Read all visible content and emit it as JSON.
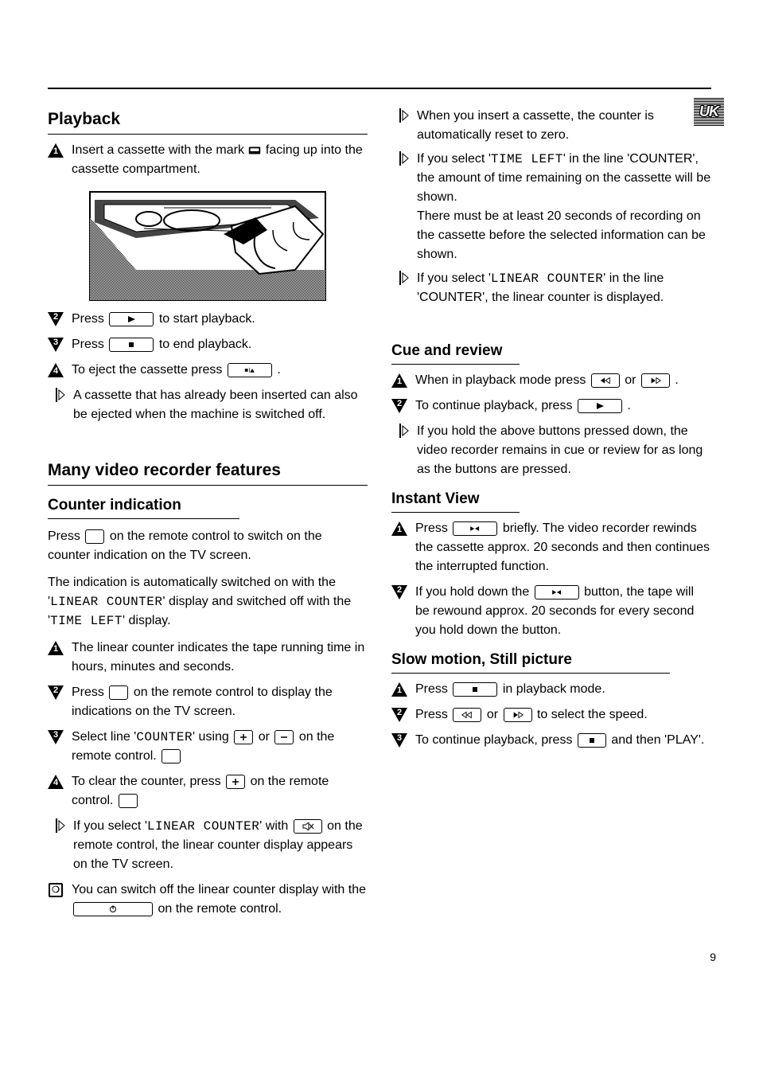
{
  "badge": "UK",
  "page_number": "9",
  "left": {
    "playback_title": "Playback",
    "s1": "Insert a cassette with the mark",
    "s1_cont": "facing up into the cassette compartment.",
    "s2_a": "Press",
    "s2_b": "to start playback.",
    "s3_a": "Press",
    "s3_b": "to end playback.",
    "s4_a": "To eject the cassette press",
    "s4_b": ".",
    "h1": "A cassette that has already been inserted can also be ejected when the machine is switched off.",
    "feat_title": "Many video recorder features",
    "ct_title": "Counter indication",
    "ct_p1a": "Press",
    "ct_p1b": "on the remote control to switch on the counter indication on the TV screen.",
    "ct_p2a": "The indication is automatically switched on with the",
    "ct_p2b": "display and switched off with the",
    "ct_p2c": "display.",
    "ct_s1": "The linear counter indicates the tape running time in hours, minutes and seconds.",
    "ct_s2a": "Press",
    "ct_s2b": "on the remote control to display the indications on the TV screen.",
    "ct_s3a": "Select line",
    "ct_s3b": "using",
    "ct_s3c": "or",
    "ct_s3d": "on the remote control.",
    "ct_s4a": "To clear the counter, press",
    "ct_s4b": "on the remote control.",
    "ct_h1a": "If you select",
    "ct_h1b": "on the remote control, the linear counter display appears on the TV screen.",
    "ct_sq_a": "You can switch off the linear counter display with the",
    "ct_sq_b": "on the remote control.",
    "LINEAR_COUNTER": "LINEAR COUNTER",
    "TIME_LEFT": "TIME LEFT",
    "COUNTER": "COUNTER",
    "LINEAR_COUNTER2": "LINEAR COUNTER"
  },
  "right": {
    "rh1": "When you insert a cassette, the counter is automatically reset to zero.",
    "rh2a": "If you select",
    "rh2b": "in the line 'COUNTER', the amount of time remaining on the cassette will be shown.",
    "rh2c": "There must be at least 20 seconds of recording on the cassette before the selected information can be shown.",
    "rh3a": "If you select",
    "rh3b": "in the line 'COUNTER', the linear counter is displayed.",
    "TIME_LEFT": "TIME LEFT",
    "LINEAR_COUNTER": "LINEAR COUNTER",
    "cue_title": "Cue and review",
    "cue_s1a": "When in playback mode press",
    "cue_s1b": "or",
    "cue_s1c": ".",
    "cue_s2a": "To continue playback, press",
    "cue_s2b": ".",
    "cue_h1": "If you hold the above buttons pressed down, the video recorder remains in cue or review for as long as the buttons are pressed.",
    "inst_title": "Instant View",
    "inst_s1a": "Press",
    "inst_s1b": "briefly. The video recorder rewinds the cassette approx. 20 seconds and then continues the interrupted function.",
    "inst_s2a": "If you hold down the",
    "inst_s2b": "button, the tape will be rewound approx. 20 seconds for every second you hold down the button.",
    "slow_title": "Slow motion, Still picture",
    "slow_s1a": "Press",
    "slow_s1b": "in playback mode.",
    "slow_s2a": "Press",
    "slow_s2b": "or",
    "slow_s2c": "to select the speed.",
    "slow_s3a": "To continue playback, press",
    "slow_s3b": "and then 'PLAY'."
  }
}
